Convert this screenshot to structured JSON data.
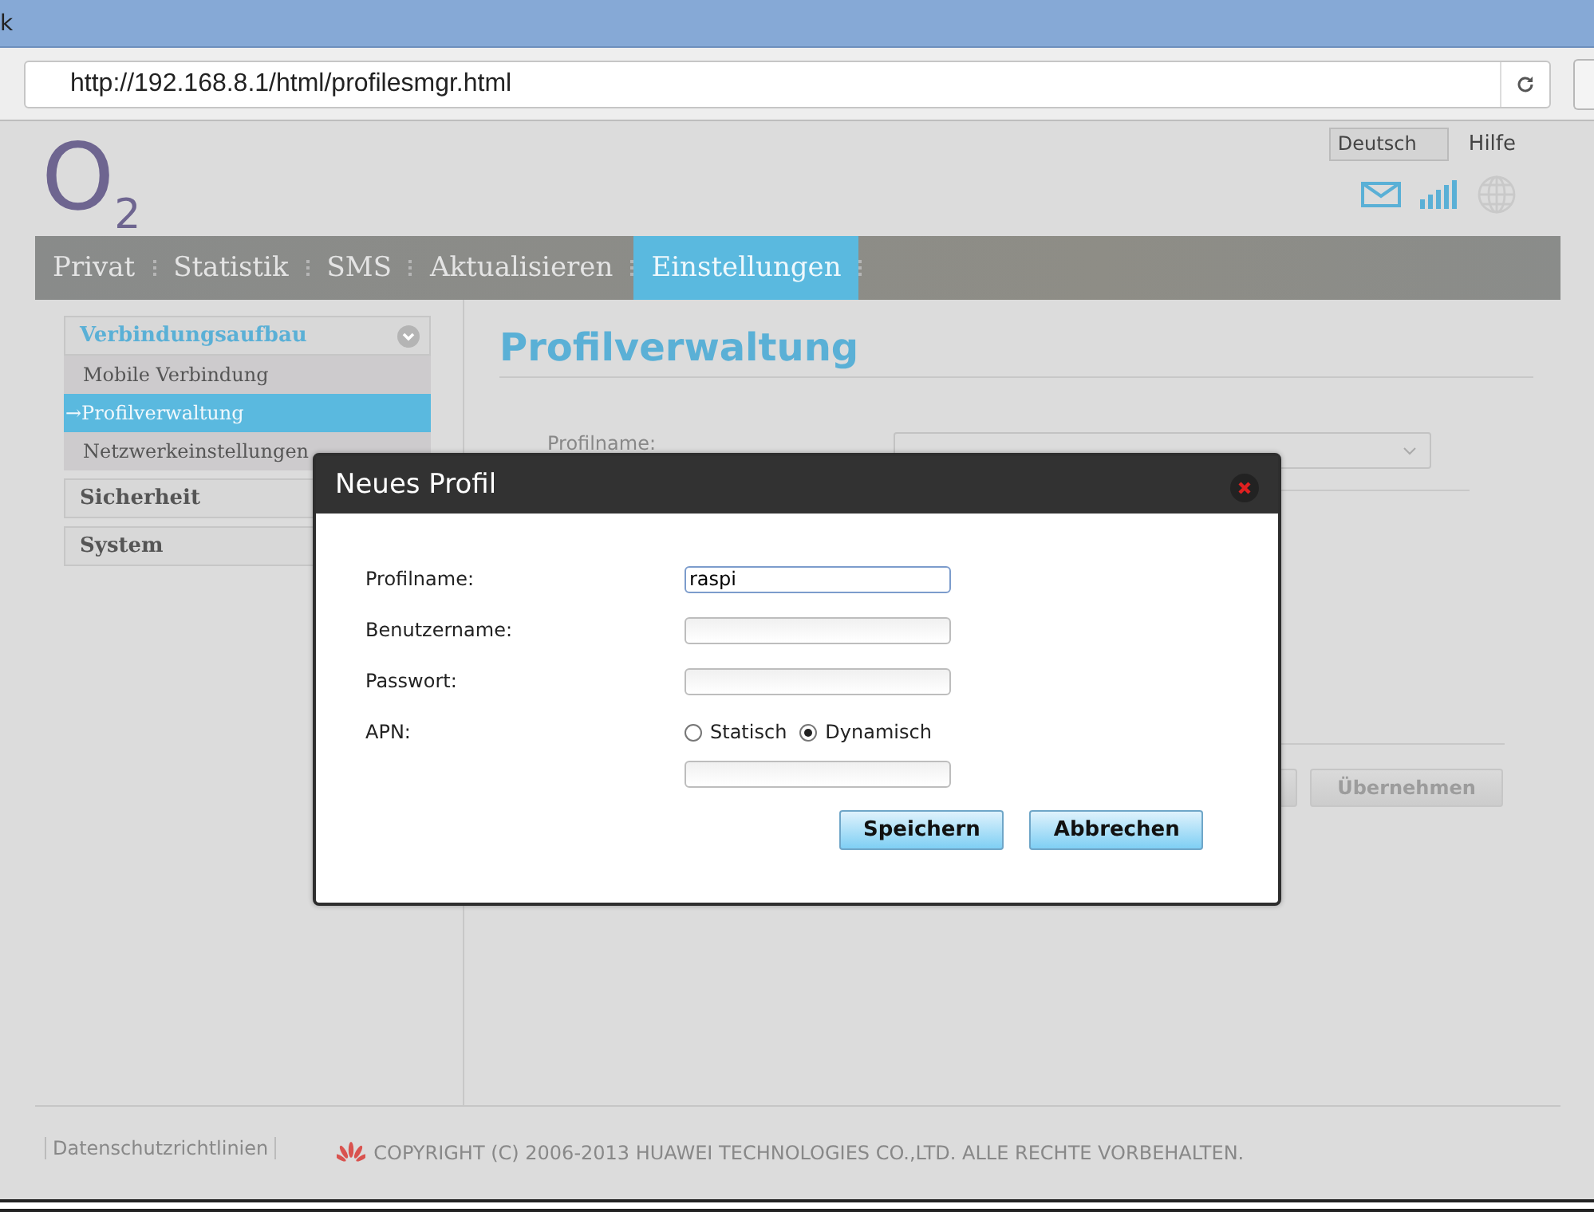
{
  "browser": {
    "title": "k",
    "url": "http://192.168.8.1/html/profilesmgr.html"
  },
  "header": {
    "logo": "O$_{2}$",
    "language": "Deutsch",
    "help": "Hilfe"
  },
  "nav": [
    {
      "label": "Privat",
      "selected": false
    },
    {
      "label": "Statistik",
      "selected": false
    },
    {
      "label": "SMS",
      "selected": false
    },
    {
      "label": "Aktualisieren",
      "selected": false
    },
    {
      "label": "Einstellungen",
      "selected": true
    }
  ],
  "sidebar": [
    {
      "label": "Verbindungsaufbau",
      "expanded": true,
      "children": [
        {
          "label": "Mobile Verbindung",
          "selected": false
        },
        {
          "label": "→Profilverwaltung",
          "selected": true
        },
        {
          "label": "Netzwerkeinstellungen",
          "selected": false
        }
      ]
    },
    {
      "label": "Sicherheit",
      "expanded": false
    },
    {
      "label": "System",
      "expanded": false
    }
  ],
  "main": {
    "title": "Profilverwaltung",
    "field_label": "Profilname:",
    "apply_button": {
      "label": "Übernehmen",
      "disabled": true
    }
  },
  "dialog": {
    "title": "Neues Profil",
    "fields": [
      {
        "kind": "text",
        "label": "Profilname:",
        "value": "raspi",
        "focused": true
      },
      {
        "kind": "text",
        "label": "Benutzername:",
        "focused": false
      },
      {
        "kind": "text",
        "label": "Passwort:",
        "focused": false
      },
      {
        "kind": "radio",
        "label": "APN:",
        "options": [
          {
            "label": "Statisch",
            "selected": false
          },
          {
            "label": "Dynamisch",
            "selected": true
          }
        ]
      },
      {
        "kind": "text",
        "focused": false
      }
    ],
    "buttons": [
      "Speichern",
      "Abbrechen"
    ]
  },
  "footer": {
    "link": "Datenschutzrichtlinien",
    "copyright": "COPYRIGHT (C) 2006-2013 HUAWEI TECHNOLOGIES CO.,LTD. ALLE RECHTE VORBEHALTEN."
  }
}
